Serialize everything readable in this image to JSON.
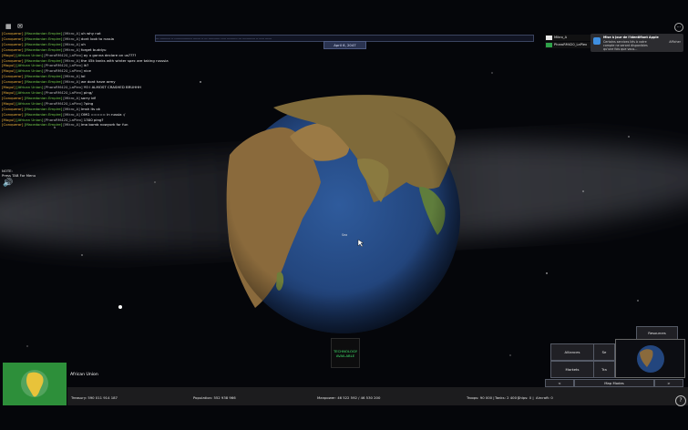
{
  "chat": [
    {
      "channel": "[Conqueror]",
      "nation": "[Macedonian Empire]",
      "user": "[Mikro_A]",
      "msg": "uh why not"
    },
    {
      "channel": "[Conqueror]",
      "nation": "[Macedonian Empire]",
      "user": "[Mikro_A]",
      "msg": "dont look to russia"
    },
    {
      "channel": "[Conqueror]",
      "nation": "[Macedonian Empire]",
      "user": "[Mikro_A]",
      "msg": "uh"
    },
    {
      "channel": "[Conqueror]",
      "nation": "[Macedonian Empire]",
      "user": "[Mikro_A]",
      "msg": "forget buddyu"
    },
    {
      "channel": "[Mogul]",
      "nation": "[African Union]",
      "user": "[PharoRM420_LaPlex]",
      "msg": "ay u gonna declare on us????"
    },
    {
      "channel": "[Conqueror]",
      "nation": "[Macedonian Empire]",
      "user": "[Mikro_A]",
      "msg": "the 45k tanks with winter spec are taking russsia"
    },
    {
      "channel": "[Mogul]",
      "nation": "[African Union]",
      "user": "[PharoRM420_LaPlex]",
      "msg": "ik?"
    },
    {
      "channel": "[Mogul]",
      "nation": "[African Union]",
      "user": "[PharoRM420_LaPlex]",
      "msg": "nice"
    },
    {
      "channel": "[Conqueror]",
      "nation": "[Macedonian Empire]",
      "user": "[Mikro_A]",
      "msg": "lol"
    },
    {
      "channel": "[Conqueror]",
      "nation": "[Macedonian Empire]",
      "user": "[Mikro_A]",
      "msg": "we dont have army"
    },
    {
      "channel": "[Mogul]",
      "nation": "[African Union]",
      "user": "[PharoRM420_LaPlex]",
      "msg": "YO I ALMOST CRASHED BRUHHH"
    },
    {
      "channel": "[Mogul]",
      "nation": "[African Union]",
      "user": "[PharoRM420_LaPlex]",
      "msg": "ping/"
    },
    {
      "channel": "[Conqueror]",
      "nation": "[Macedonian Empire]",
      "user": "[Mikro_A]",
      "msg": "sorry idf"
    },
    {
      "channel": "[Mogul]",
      "nation": "[African Union]",
      "user": "[PharoRM420_LaPlex]",
      "msg": "?ping"
    },
    {
      "channel": "[Conqueror]",
      "nation": "[Macedonian Empire]",
      "user": "[Mikro_A]",
      "msg": "lmsh its ok"
    },
    {
      "channel": "[Conqueror]",
      "nation": "[Macedonian Empire]",
      "user": "[Mikro_A]",
      "msg": "OMG ===== in russia :/"
    },
    {
      "channel": "[Mogul]",
      "nation": "[African Union]",
      "user": "[PharoRM420_LaPlex]",
      "msg": "1300 ping?"
    },
    {
      "channel": "[Conqueror]",
      "nation": "[Macedonian Empire]",
      "user": "[Mikro_A]",
      "msg": "ima bomb nowyork for fun"
    }
  ],
  "ticker": "--- ---------- -- ----------------- ------- -- --- ----------- ----- ---------- --- ------------ -- ----- ------",
  "date": "April 6, 2047",
  "leaderboard": [
    {
      "name": "Mikro_A",
      "flag_color": "#e8e8e8"
    },
    {
      "name": "PharoRM420_LaPlex",
      "flag_color": "#2fa24a"
    }
  ],
  "notification": {
    "title": "Mise à jour de l'identifiant Apple",
    "body": "Certains services liés à votre compte ne seront disponibles qu'une fois que vous...",
    "dismiss": "Afficher"
  },
  "help_hint": {
    "line1": "NOTE:",
    "line2": "Press TAB For Menu"
  },
  "sea_label": "Sea",
  "technology": {
    "line1": "TECHNOLOGY",
    "line2": "AVAILABLE"
  },
  "player": {
    "nation": "African Union",
    "flag_color": "#2d8f3a",
    "treasury_label": "Treasury:",
    "treasury": "590 011 914 187",
    "population_label": "Population:",
    "population": "552 938 966",
    "manpower_label": "Manpower:",
    "manpower": "46 522 592 / 46 530 200",
    "troops_label": "Troops:",
    "troops": "90 000",
    "tanks_label": "Tanks:",
    "tanks": "2 400",
    "ships_label": "Ships:",
    "ships": "0",
    "aircraft_label": "Aircraft:",
    "aircraft": "0"
  },
  "panel": {
    "resources": "Resources",
    "btn1": "Alliances",
    "btn2": "Se",
    "btn3": "Markets",
    "btn4": "Tra",
    "prev": "<",
    "mapmodes": "Map Modes",
    "next": ">"
  },
  "colors": {
    "ocean": "#2a4f8a",
    "land": "#8a6a3c",
    "space": "#05060a"
  }
}
